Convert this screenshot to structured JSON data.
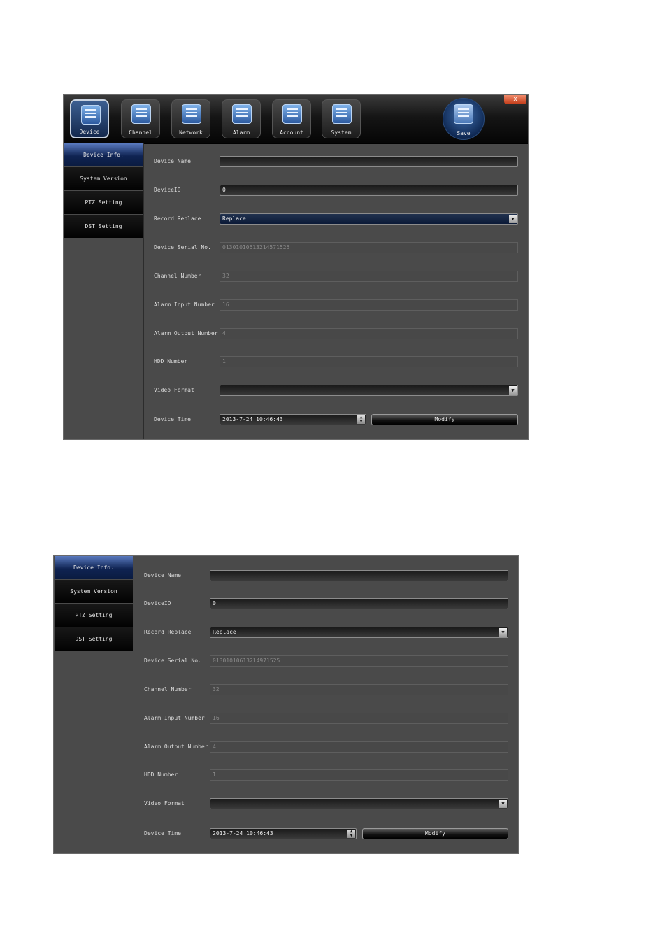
{
  "window1": {
    "close_label": "x",
    "toolbar": {
      "tabs": [
        {
          "label": "Device",
          "icon": "device-icon"
        },
        {
          "label": "Channel",
          "icon": "channel-icon"
        },
        {
          "label": "Network",
          "icon": "network-icon"
        },
        {
          "label": "Alarm",
          "icon": "alarm-icon"
        },
        {
          "label": "Account",
          "icon": "account-icon"
        },
        {
          "label": "System",
          "icon": "system-icon"
        }
      ],
      "active_tab": "Device",
      "save_label": "Save"
    }
  },
  "sidebar": {
    "items": [
      "Device Info.",
      "System Version",
      "PTZ Setting",
      "DST Setting"
    ],
    "active": "Device Info."
  },
  "form": {
    "device_name": {
      "label": "Device Name",
      "value": ""
    },
    "device_id": {
      "label": "DeviceID",
      "value": "0"
    },
    "record_replace": {
      "label": "Record Replace",
      "value": "Replace"
    },
    "device_serial": {
      "label": "Device Serial No.",
      "value_1": "01301010613214571525",
      "value_2": "01301010613214971525"
    },
    "channel_number": {
      "label": "Channel Number",
      "value": "32"
    },
    "alarm_input": {
      "label": "Alarm Input Number",
      "value": "16"
    },
    "alarm_output": {
      "label": "Alarm Output Number",
      "value": "4"
    },
    "hdd_number": {
      "label": "HDD Number",
      "value": "1"
    },
    "video_format": {
      "label": "Video Format",
      "value": ""
    },
    "device_time": {
      "label": "Device Time",
      "value": "2013-7-24 10:46:43"
    },
    "modify_label": "Modify"
  },
  "colors": {
    "accent": "#1c3a73",
    "panel": "#4a4a4a",
    "toolbar": "#0a0a0a"
  }
}
